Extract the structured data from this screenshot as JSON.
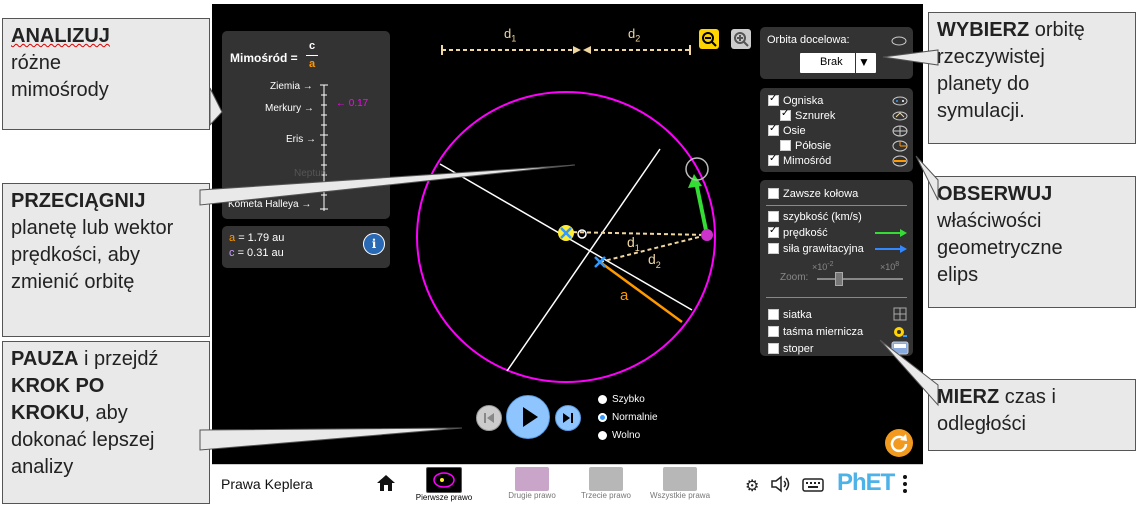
{
  "callouts": {
    "analyze": {
      "bold": "ANALIZUJ",
      "rest": [
        "różne",
        "mimośrody"
      ]
    },
    "drag": {
      "bold": "PRZECIĄGNIJ",
      "rest": [
        "planetę lub wektor",
        "prędkości, aby",
        "zmienić orbitę"
      ]
    },
    "pause": {
      "bold1": "PAUZA",
      "mid1": " i przejdź",
      "bold2a": "KROK PO",
      "bold2b": "KROKU",
      "mid2": ", aby",
      "rest": [
        "dokonać lepszej",
        "analizy"
      ]
    },
    "choose": {
      "bold": "WYBIERZ",
      "first": " orbitę",
      "rest": [
        "rzeczywistej",
        "planety do",
        "symulacji."
      ]
    },
    "observe": {
      "bold": "OBSERWUJ",
      "rest": [
        "właściwości",
        "geometryczne",
        "elips"
      ]
    },
    "measure": {
      "bold": "MIERZ",
      "first": " czas i",
      "rest": [
        "odległości"
      ]
    }
  },
  "eccentricity_panel": {
    "title_prefix": "Mimośród =",
    "frac_num": "c",
    "frac_den": "a",
    "scale_labels": [
      "Ziemia",
      "Merkury",
      "Eris",
      "Neptun",
      "Kometa Halleya"
    ],
    "marker_value": "0.17",
    "marker_color": "#ff00ff"
  },
  "values_panel": {
    "a_label": "a",
    "a_value": "= 1.79 au",
    "c_label": "c",
    "c_value": "= 0.31 au"
  },
  "top_distance": {
    "d1": "d",
    "d1_sub": "1",
    "d2": "d",
    "d2_sub": "2"
  },
  "orbit_labels": {
    "d1": "d",
    "d1_sub": "1",
    "d2": "d",
    "d2_sub": "2",
    "a": "a"
  },
  "target_panel": {
    "label": "Orbita docelowa:",
    "select_value": "Brak"
  },
  "geometry_panel": {
    "items": [
      {
        "label": "Ogniska",
        "checked": true
      },
      {
        "label": "Sznurek",
        "checked": true
      },
      {
        "label": "Osie",
        "checked": true
      },
      {
        "label": "Półosie",
        "checked": false
      },
      {
        "label": "Mimośród",
        "checked": true
      }
    ]
  },
  "vectors_panel": {
    "always_circular": "Zawsze kołowa",
    "speed": "szybkość (km/s)",
    "velocity": "prędkość",
    "gravity": "siła grawitacyjna",
    "zoom_label": "Zoom:",
    "zoom_min": "×10",
    "zoom_min_exp": "-2",
    "zoom_max": "×10",
    "zoom_max_exp": "8",
    "grid": "siatka",
    "tape": "taśma miernicza",
    "stopwatch": "stoper"
  },
  "speed_options": {
    "fast": "Szybko",
    "normal": "Normalnie",
    "slow": "Wolno",
    "selected": "normal"
  },
  "navbar": {
    "title": "Prawa Keplera",
    "tabs": [
      "Pierwsze prawo",
      "Drugie prawo",
      "Trzecie prawo",
      "Wszystkie prawa"
    ],
    "brand": "PhET"
  },
  "colors": {
    "orbit": "#ff00ff",
    "velocity": "#33dd33",
    "gravity": "#3388ff",
    "semi_major": "#ff9900",
    "string": "#f0d7a0"
  }
}
